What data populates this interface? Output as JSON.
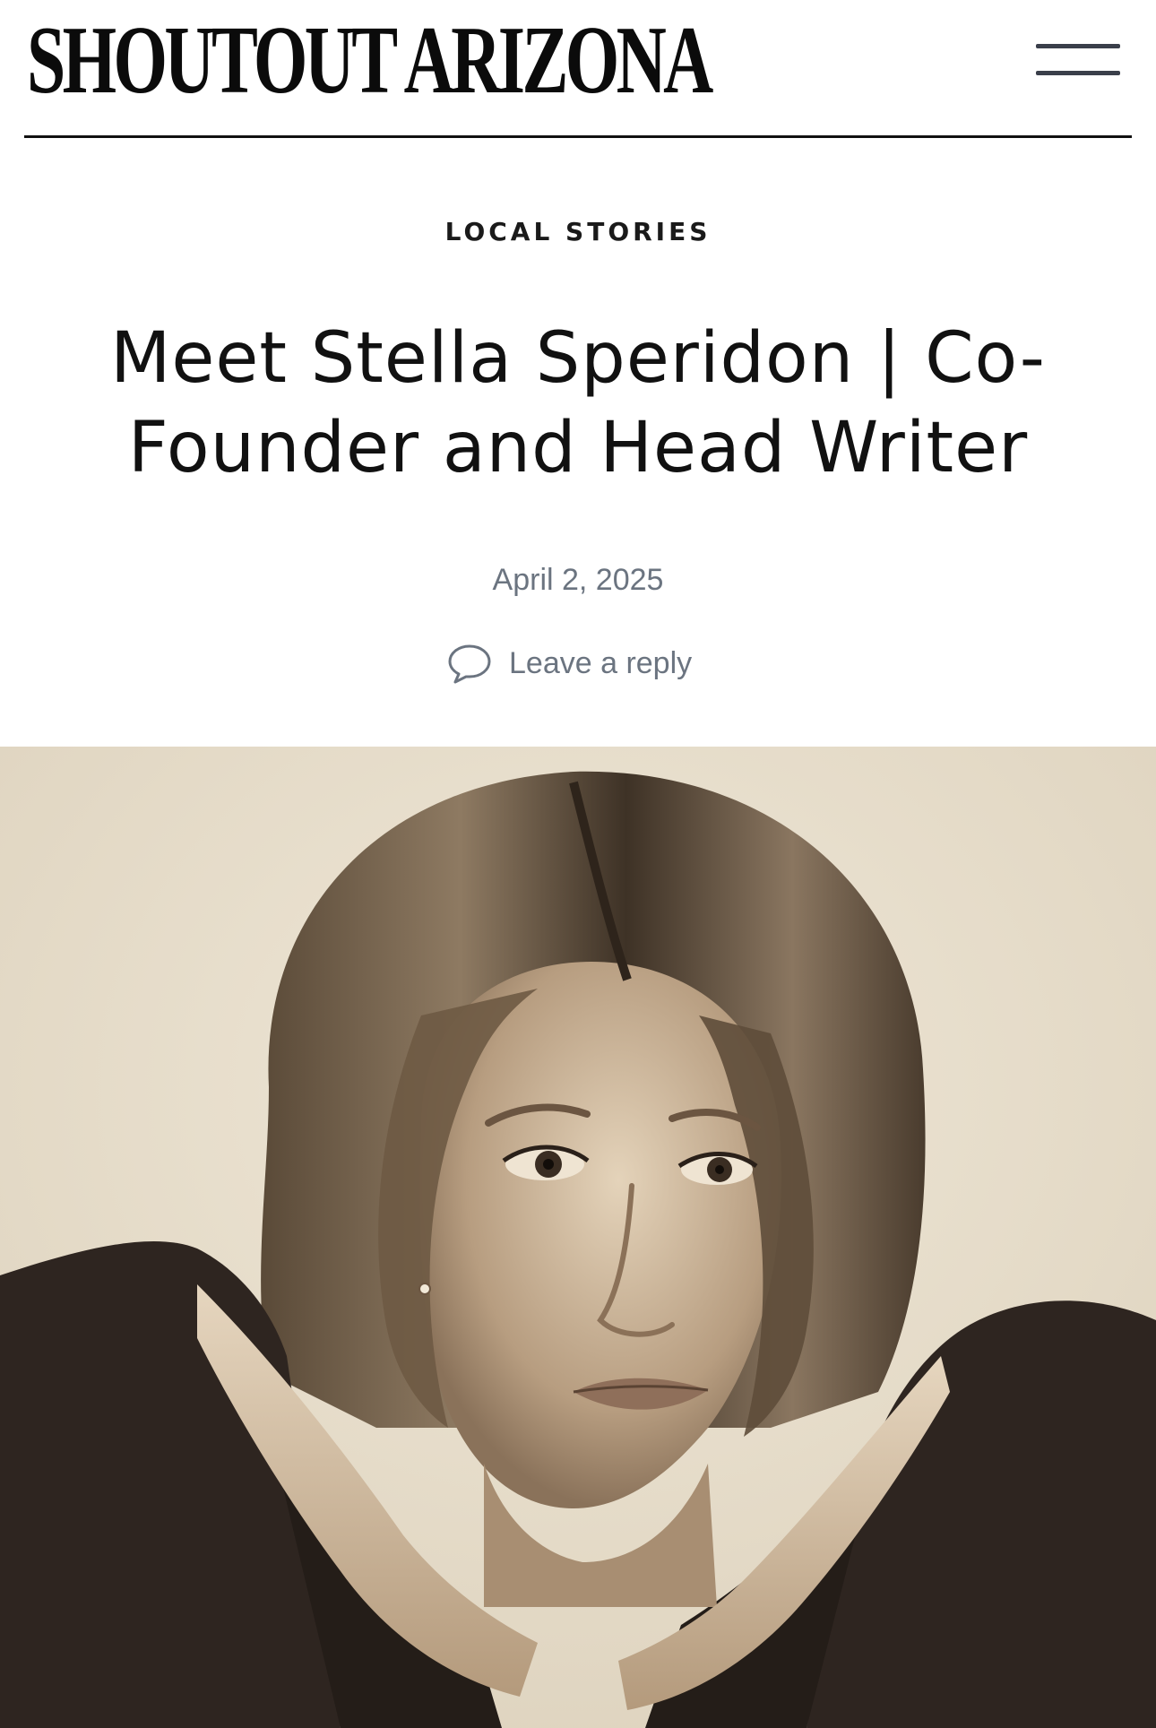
{
  "header": {
    "logo_text": "SHOUTOUT ARIZONA",
    "menu_icon": "hamburger-menu-icon"
  },
  "article": {
    "category": "LOCAL STORIES",
    "title": "Meet Stella Speridon | Co-Founder and Head Writer",
    "date": "April 2, 2025",
    "reply_label": "Leave a reply",
    "reply_icon": "comment-bubble-icon"
  },
  "colors": {
    "text_primary": "#111111",
    "text_meta": "#6b7480",
    "header_rule": "#111111",
    "photo_tone": "#e9e0cf"
  }
}
